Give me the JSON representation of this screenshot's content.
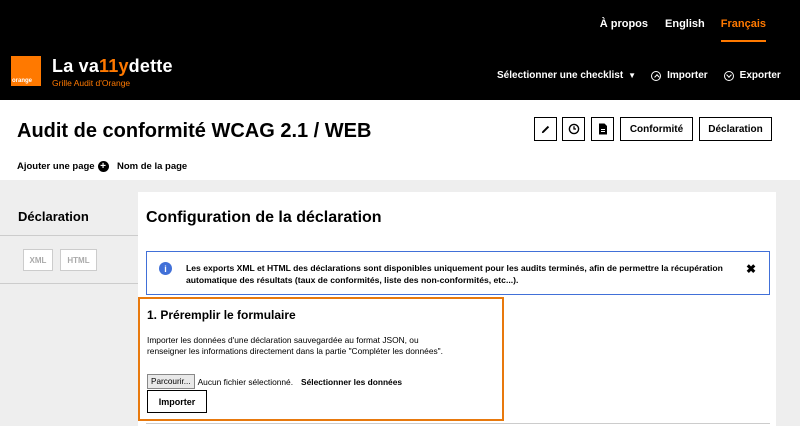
{
  "header": {
    "top_links": {
      "about": "À propos",
      "english": "English",
      "french": "Français"
    },
    "logo_text": "orange",
    "app_title_prefix": "La va",
    "app_title_accent": "11y",
    "app_title_suffix": "dette",
    "app_subtitle": "Grille Audit d'Orange",
    "nav": {
      "select_checklist": "Sélectionner une checklist",
      "import": "Importer",
      "export": "Exporter"
    }
  },
  "audit": {
    "title": "Audit de conformité WCAG 2.1 / WEB",
    "buttons": {
      "conformity": "Conformité",
      "declaration": "Déclaration"
    },
    "add_page": "Ajouter une page",
    "page_name": "Nom de la page"
  },
  "sidebar": {
    "title": "Déclaration",
    "formats": [
      "XML",
      "HTML"
    ]
  },
  "main": {
    "title": "Configuration de la déclaration",
    "info": {
      "icon": "i",
      "text": "Les exports XML et HTML des déclarations sont disponibles uniquement pour les audits terminés, afin de permettre la récupération automatique des résultats (taux de conformités, liste des non-conformités, etc...).",
      "close": "✖"
    },
    "prefill": {
      "heading": "1. Préremplir le formulaire",
      "description": "Importer les données d'une déclaration sauvegardée au format JSON, ou renseigner les informations directement dans la partie \"Compléter les données\".",
      "browse": "Parcourir...",
      "no_file": "Aucun fichier sélectionné.",
      "select_data": "Sélectionner les données",
      "import_button": "Importer"
    }
  },
  "colors": {
    "brand_orange": "#ff7900",
    "info_blue": "#4170d8",
    "highlight": "#e8790d"
  }
}
